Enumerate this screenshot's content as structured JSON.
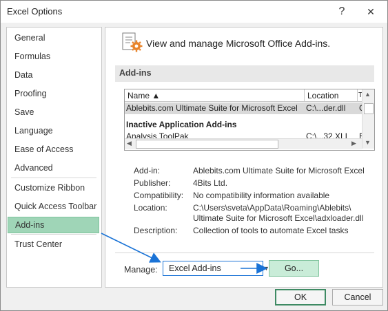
{
  "window": {
    "title": "Excel Options",
    "help_glyph": "?",
    "close_glyph": "✕"
  },
  "nav": {
    "items": [
      {
        "label": "General"
      },
      {
        "label": "Formulas"
      },
      {
        "label": "Data"
      },
      {
        "label": "Proofing"
      },
      {
        "label": "Save"
      },
      {
        "label": "Language"
      },
      {
        "label": "Ease of Access"
      },
      {
        "label": "Advanced"
      },
      {
        "label": "Customize Ribbon"
      },
      {
        "label": "Quick Access Toolbar"
      },
      {
        "label": "Add-ins"
      },
      {
        "label": "Trust Center"
      }
    ],
    "selected": "Add-ins"
  },
  "main": {
    "header_text": "View and manage Microsoft Office Add-ins.",
    "header_icon": "addins-gear-icon",
    "section_title": "Add-ins",
    "grid": {
      "col_name": "Name ▲",
      "col_location": "Location",
      "col_type": "T",
      "active_row": {
        "name": "Ablebits.com Ultimate Suite for Microsoft Excel",
        "location": "C:\\...der.dll",
        "type": "C"
      },
      "group_label": "Inactive Application Add-ins",
      "inactive_row": {
        "name": "Analysis ToolPak",
        "location": "C:\\...32.XLL",
        "type": "E"
      }
    },
    "details": {
      "addin_label": "Add-in:",
      "addin_value": "Ablebits.com Ultimate Suite for Microsoft Excel",
      "publisher_label": "Publisher:",
      "publisher_value": "4Bits Ltd.",
      "compat_label": "Compatibility:",
      "compat_value": "No compatibility information available",
      "location_label": "Location:",
      "location_line1": "C:\\Users\\sveta\\AppData\\Roaming\\Ablebits\\",
      "location_line2": "Ultimate Suite for Microsoft Excel\\adxloader.dll",
      "desc_label": "Description:",
      "desc_value": "Collection of tools to automate Excel tasks"
    },
    "manage": {
      "label": "Manage:",
      "selected": "Excel Add-ins",
      "go_label": "Go..."
    }
  },
  "footer": {
    "ok_label": "OK",
    "cancel_label": "Cancel"
  },
  "colors": {
    "selection_green": "#9fd5b7",
    "go_button_green": "#c9ecd8",
    "annotation_blue": "#1a73d6"
  }
}
